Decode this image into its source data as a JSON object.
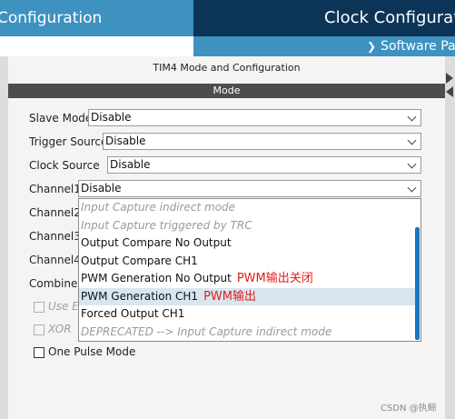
{
  "header": {
    "left_title": "Configuration",
    "right_title": "Clock Configuration",
    "right_sub_icon": "chevron-down-icon",
    "right_sub_text": "Software Pa"
  },
  "panel": {
    "title": "TIM4 Mode and Configuration",
    "mode_label": "Mode"
  },
  "fields": {
    "slave_mode": {
      "label": "Slave Mode",
      "value": "Disable"
    },
    "trigger_source": {
      "label": "Trigger Source",
      "value": "Disable"
    },
    "clock_source": {
      "label": "Clock Source",
      "value": "Disable"
    },
    "channel1": {
      "label": "Channel1",
      "value": "Disable"
    },
    "channel2": {
      "label": "Channel2"
    },
    "channel3": {
      "label": "Channel3"
    },
    "channel4": {
      "label": "Channel4"
    },
    "combined": {
      "label": "Combined"
    },
    "use_e": {
      "label": "Use E"
    },
    "xor": {
      "label": "XOR"
    },
    "one_pulse": {
      "label": "One Pulse Mode"
    }
  },
  "dropdown": {
    "options": [
      {
        "label": "Input Capture indirect mode",
        "disabled": true,
        "note": ""
      },
      {
        "label": "Input Capture triggered by TRC",
        "disabled": true,
        "note": ""
      },
      {
        "label": "Output Compare No Output",
        "disabled": false,
        "note": ""
      },
      {
        "label": "Output Compare CH1",
        "disabled": false,
        "note": ""
      },
      {
        "label": "PWM Generation No Output",
        "disabled": false,
        "note": "PWM输出关闭"
      },
      {
        "label": "PWM Generation CH1",
        "disabled": false,
        "selected": true,
        "note": "PWM输出"
      },
      {
        "label": "Forced Output CH1",
        "disabled": false,
        "note": ""
      },
      {
        "label": "DEPRECATED --> Input Capture indirect mode",
        "disabled": true,
        "note": ""
      }
    ]
  },
  "watermark": "CSDN @执鲸",
  "colors": {
    "header_light": "#3d92bf",
    "header_dark": "#0c3457",
    "mode_bar": "#4d4d4d",
    "annotation_red": "#e31b1b",
    "selected_row": "#d8e6f0"
  }
}
